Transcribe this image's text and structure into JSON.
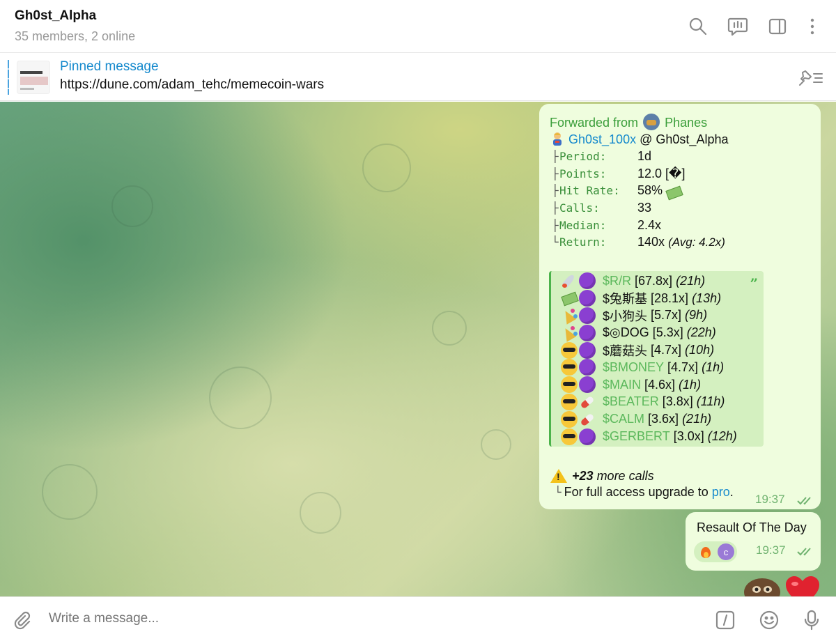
{
  "header": {
    "title": "Gh0st_Alpha",
    "subtitle": "35 members, 2 online",
    "icons": [
      "search-icon",
      "video-chat-icon",
      "sidebar-toggle-icon",
      "more-vertical-icon"
    ]
  },
  "pinned": {
    "title": "Pinned message",
    "text": "https://dune.com/adam_tehc/memecoin-wars"
  },
  "message": {
    "forward_label": "Forwarded from",
    "forward_name": "Phanes",
    "sender_name": "Gh0st_100x",
    "sender_at": "@",
    "sender_group": "Gh0st_Alpha",
    "stats": [
      {
        "tree": "├",
        "key": "Period:",
        "value": "1d"
      },
      {
        "tree": "├",
        "key": "Points:",
        "value": "12.0  [�]"
      },
      {
        "tree": "├",
        "key": "Hit Rate:",
        "value": "58%"
      },
      {
        "tree": "├",
        "key": "Calls:",
        "value": "33"
      },
      {
        "tree": "├",
        "key": "Median:",
        "value": "2.4x"
      },
      {
        "tree": "└",
        "key": "Return:",
        "value": "140x",
        "extra": "(Avg: 4.2x)"
      }
    ],
    "quote_mark": "”",
    "calls": [
      {
        "emoji1": "rocket",
        "emoji2": "purple-circle",
        "symbol": "$R/R",
        "symbol_dark": false,
        "mult": "[67.8x]",
        "age": "(21h)"
      },
      {
        "emoji1": "money-wings",
        "emoji2": "purple-circle",
        "symbol": "$兔斯基",
        "symbol_dark": true,
        "mult": "[28.1x]",
        "age": "(13h)"
      },
      {
        "emoji1": "party-popper",
        "emoji2": "purple-circle",
        "symbol": "$小狗头",
        "symbol_dark": true,
        "mult": "[5.7x]",
        "age": "(9h)"
      },
      {
        "emoji1": "party-popper",
        "emoji2": "purple-circle",
        "symbol": "$◎DOG",
        "symbol_dark": true,
        "mult": "[5.3x]",
        "age": "(22h)"
      },
      {
        "emoji1": "cool-face",
        "emoji2": "purple-circle",
        "symbol": "$蘑菇头",
        "symbol_dark": true,
        "mult": "[4.7x]",
        "age": "(10h)"
      },
      {
        "emoji1": "cool-face",
        "emoji2": "purple-circle",
        "symbol": "$BMONEY",
        "symbol_dark": false,
        "mult": "[4.7x]",
        "age": "(1h)"
      },
      {
        "emoji1": "cool-face",
        "emoji2": "purple-circle",
        "symbol": "$MAIN",
        "symbol_dark": false,
        "mult": "[4.6x]",
        "age": "(1h)"
      },
      {
        "emoji1": "cool-face",
        "emoji2": "pill",
        "symbol": "$BEATER",
        "symbol_dark": false,
        "mult": "[3.8x]",
        "age": "(11h)"
      },
      {
        "emoji1": "cool-face",
        "emoji2": "pill",
        "symbol": "$CALM",
        "symbol_dark": false,
        "mult": "[3.6x]",
        "age": "(21h)"
      },
      {
        "emoji1": "cool-face",
        "emoji2": "purple-circle",
        "symbol": "$GERBERT",
        "symbol_dark": false,
        "mult": "[3.0x]",
        "age": "(12h)"
      }
    ],
    "more_count": "+23",
    "more_label": "more calls",
    "upgrade_tree": "└",
    "upgrade_text": "For full access upgrade to",
    "upgrade_link": "pro",
    "upgrade_end": ".",
    "time": "19:37"
  },
  "message2": {
    "text": "Resault Of The Day",
    "reaction_avatar": "c",
    "time": "19:37"
  },
  "composer": {
    "placeholder": "Write a message...",
    "icons": [
      "attach-icon",
      "commands-icon",
      "emoji-icon",
      "microphone-icon"
    ]
  },
  "colors": {
    "link": "#168acd",
    "bubble": "#effdde",
    "green_key": "#3a8f3a",
    "icon_gray": "#8a8a8a"
  }
}
